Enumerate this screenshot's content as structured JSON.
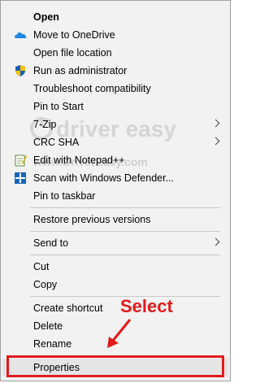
{
  "menu": {
    "items": [
      {
        "label": "Open"
      },
      {
        "label": "Move to OneDrive"
      },
      {
        "label": "Open file location"
      },
      {
        "label": "Run as administrator"
      },
      {
        "label": "Troubleshoot compatibility"
      },
      {
        "label": "Pin to Start"
      },
      {
        "label": "7-Zip"
      },
      {
        "label": "CRC SHA"
      },
      {
        "label": "Edit with Notepad++"
      },
      {
        "label": "Scan with Windows Defender..."
      },
      {
        "label": "Pin to taskbar"
      },
      {
        "label": "Restore previous versions"
      },
      {
        "label": "Send to"
      },
      {
        "label": "Cut"
      },
      {
        "label": "Copy"
      },
      {
        "label": "Create shortcut"
      },
      {
        "label": "Delete"
      },
      {
        "label": "Rename"
      },
      {
        "label": "Properties"
      }
    ]
  },
  "annotation": {
    "text": "Select"
  },
  "watermark": {
    "brand": "driver easy",
    "url": "www.DriverEasy.com"
  },
  "colors": {
    "annotation_red": "#e21a1a",
    "onedrive_blue": "#1e88e5",
    "defender_blue": "#1565c0"
  }
}
